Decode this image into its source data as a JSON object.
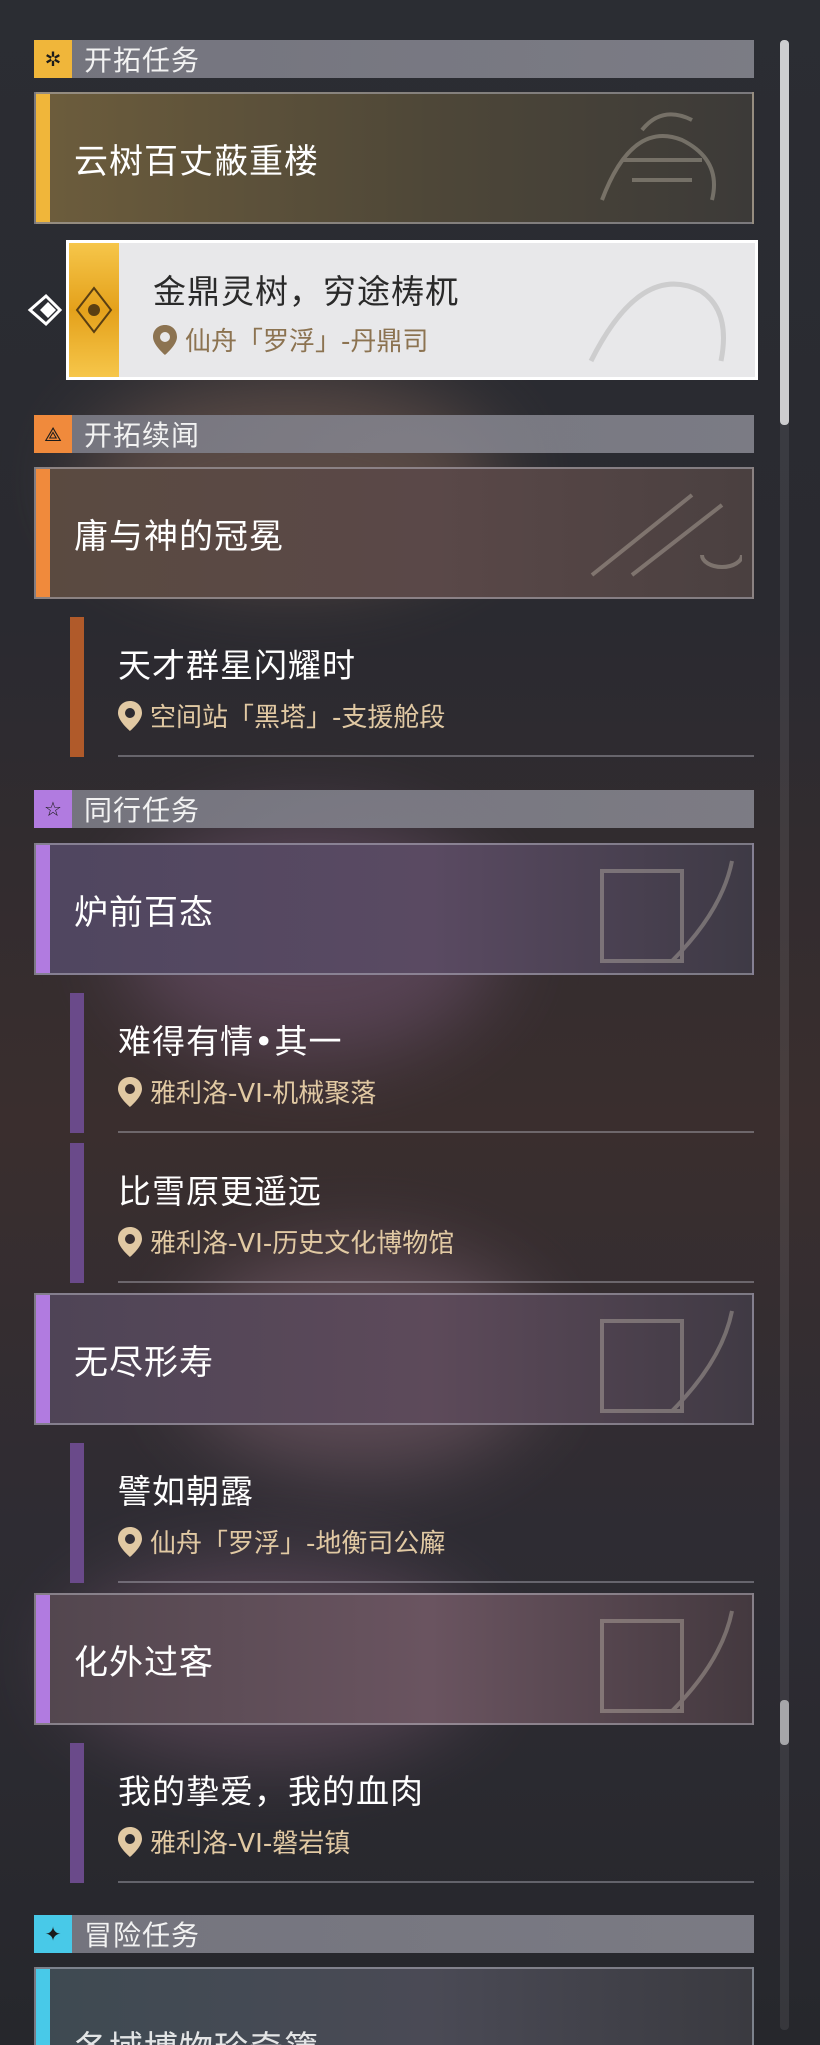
{
  "colors": {
    "trailblaze": "#f0b63a",
    "trailblaze_cont": "#f08a3c",
    "companion": "#b17be0",
    "adventure": "#48c9e8",
    "location": "#e1c9a3"
  },
  "sections": [
    {
      "label": "开拓任务",
      "icon": "trailblaze-mission-icon"
    },
    {
      "label": "开拓续闻",
      "icon": "trailblaze-continuance-icon"
    },
    {
      "label": "同行任务",
      "icon": "companion-mission-icon"
    },
    {
      "label": "冒险任务",
      "icon": "adventure-mission-icon"
    }
  ],
  "groups": [
    {
      "title": "云树百丈蔽重楼"
    },
    {
      "title": "庸与神的冠冕"
    },
    {
      "title": "炉前百态"
    },
    {
      "title": "无尽形寿"
    },
    {
      "title": "化外过客"
    },
    {
      "title": "各域博物珍奇簿"
    }
  ],
  "selected": {
    "title": "金鼎灵树，穷途梼杌",
    "location": "仙舟「罗浮」-丹鼎司"
  },
  "items": [
    {
      "title": "天才群星闪耀时",
      "location": "空间站「黑塔」-支援舱段"
    },
    {
      "title": "难得有情•其一",
      "location": "雅利洛-VI-机械聚落"
    },
    {
      "title": "比雪原更遥远",
      "location": "雅利洛-VI-历史文化博物馆"
    },
    {
      "title": "譬如朝露",
      "location": "仙舟「罗浮」-地衡司公廨"
    },
    {
      "title": "我的挚爱，我的血肉",
      "location": "雅利洛-VI-磐岩镇"
    }
  ]
}
